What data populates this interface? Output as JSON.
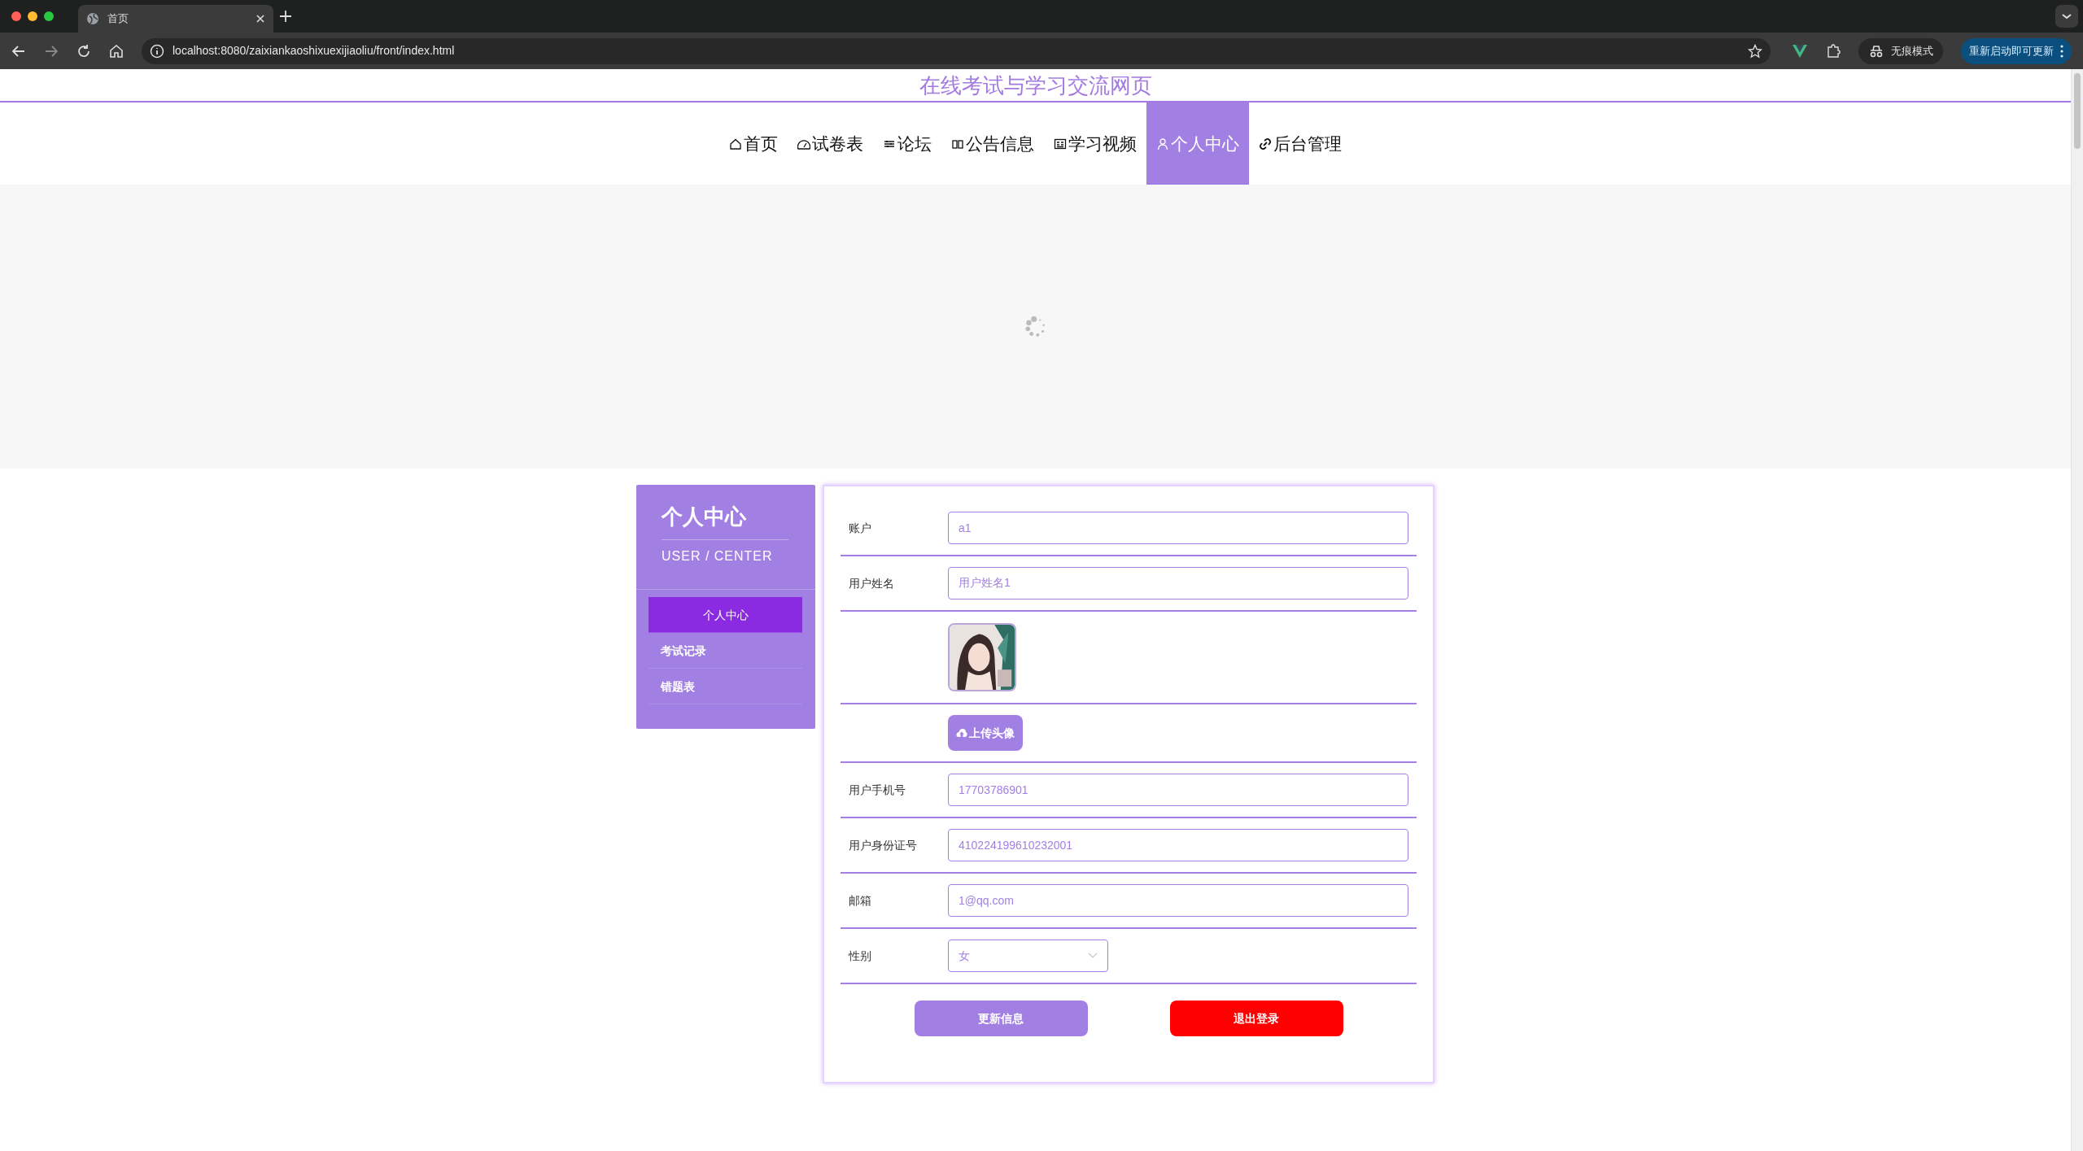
{
  "browser": {
    "tabs": [
      {
        "title": "首页",
        "selected": true
      }
    ],
    "url": "localhost:8080/zaixiankaoshixuexijiaoliu/front/index.html",
    "incognito": "无痕模式",
    "update": "重新启动即可更新"
  },
  "site_title": "在线考试与学习交流网页",
  "nav": [
    {
      "label": "首页",
      "selected": false
    },
    {
      "label": "试卷表",
      "selected": false
    },
    {
      "label": "论坛",
      "selected": false
    },
    {
      "label": "公告信息",
      "selected": false
    },
    {
      "label": "学习视频",
      "selected": false
    },
    {
      "label": "个人中心",
      "selected": true
    },
    {
      "label": "后台管理",
      "selected": false
    }
  ],
  "sidebar": {
    "title": "个人中心",
    "subtitle": "USER / CENTER",
    "items": [
      {
        "label": "个人中心",
        "selected": true
      },
      {
        "label": "考试记录",
        "selected": false
      },
      {
        "label": "错题表",
        "selected": false
      }
    ]
  },
  "form": {
    "fields": [
      {
        "kind": "input",
        "label": "账户",
        "value": "a1"
      },
      {
        "kind": "input",
        "label": "用户姓名",
        "value": "用户姓名1"
      },
      {
        "kind": "avatar"
      },
      {
        "kind": "upload",
        "button": "上传头像"
      },
      {
        "kind": "input",
        "label": "用户手机号",
        "value": "17703786901"
      },
      {
        "kind": "input",
        "label": "用户身份证号",
        "value": "410224199610232001"
      },
      {
        "kind": "input",
        "label": "邮箱",
        "value": "1@qq.com"
      },
      {
        "kind": "select",
        "label": "性别",
        "value": "女"
      }
    ],
    "buttons": [
      {
        "kind": "primary",
        "label": "更新信息"
      },
      {
        "kind": "danger",
        "label": "退出登录"
      }
    ]
  }
}
